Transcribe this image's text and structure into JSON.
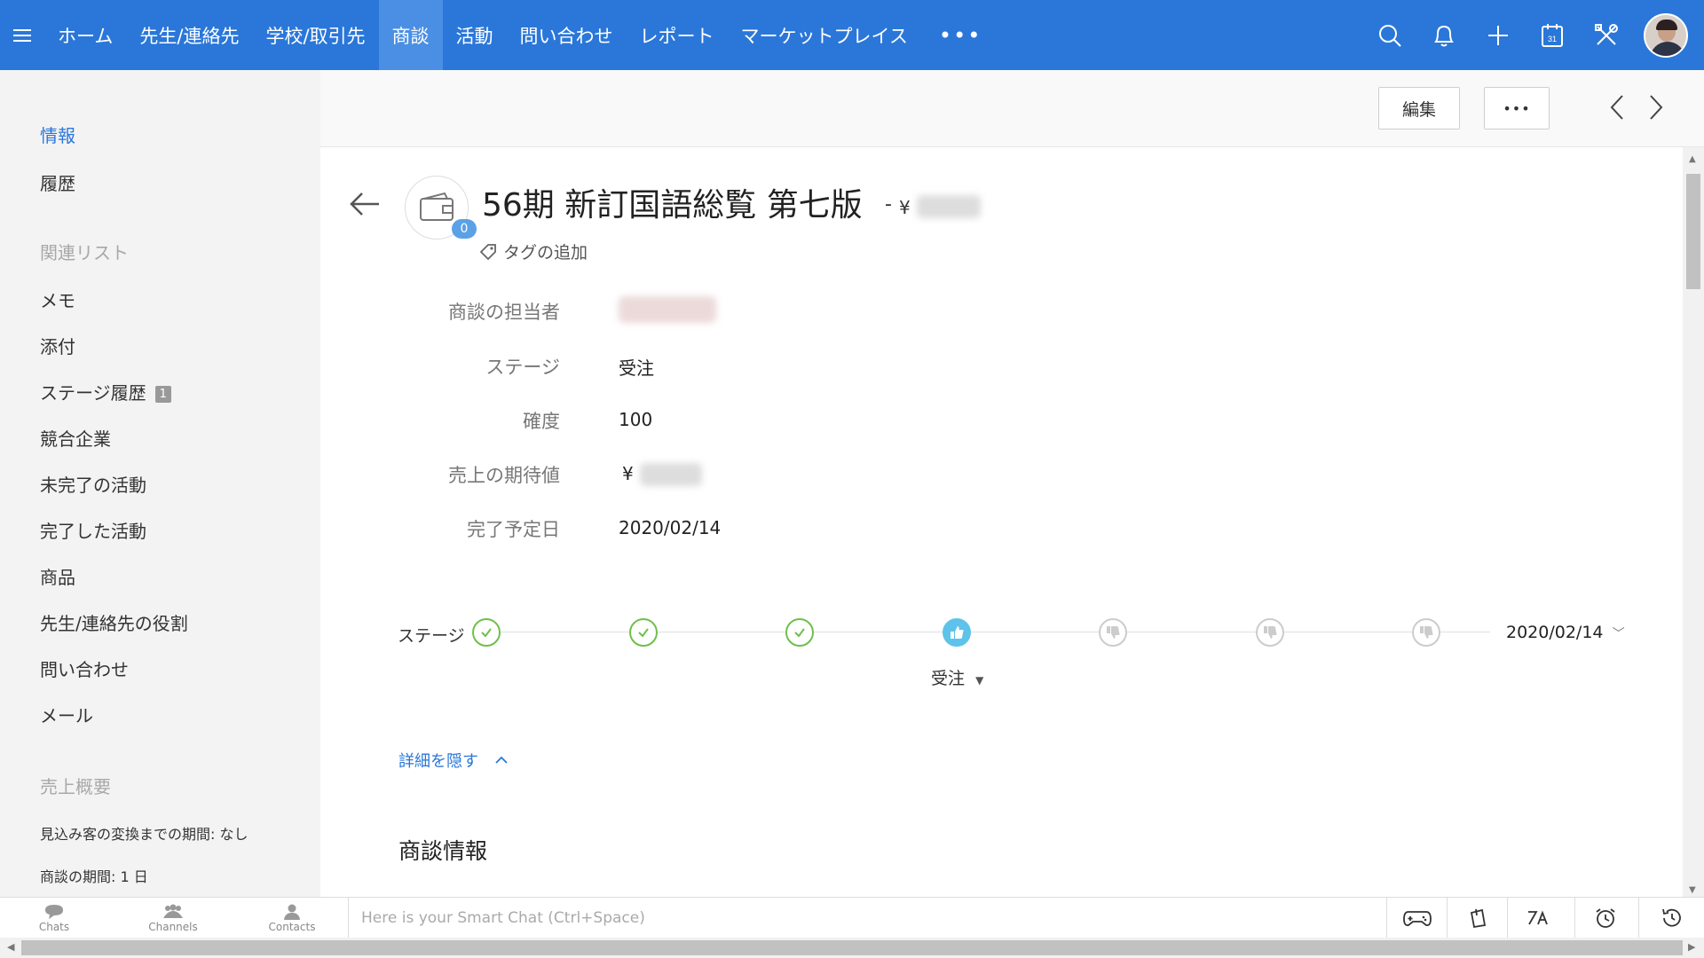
{
  "nav": {
    "items": [
      {
        "label": "ホーム",
        "active": false
      },
      {
        "label": "先生/連絡先",
        "active": false
      },
      {
        "label": "学校/取引先",
        "active": false
      },
      {
        "label": "商談",
        "active": true
      },
      {
        "label": "活動",
        "active": false
      },
      {
        "label": "問い合わせ",
        "active": false
      },
      {
        "label": "レポート",
        "active": false
      },
      {
        "label": "マーケットプレイス",
        "active": false
      }
    ],
    "more": "•••",
    "calendar_day": "31"
  },
  "sidebar": {
    "info": "情報",
    "history": "履歴",
    "related_heading": "関連リスト",
    "related": [
      {
        "label": "メモ"
      },
      {
        "label": "添付"
      },
      {
        "label": "ステージ履歴",
        "badge": "1"
      },
      {
        "label": "競合企業"
      },
      {
        "label": "未完了の活動"
      },
      {
        "label": "完了した活動"
      },
      {
        "label": "商品"
      },
      {
        "label": "先生/連絡先の役割"
      },
      {
        "label": "問い合わせ"
      },
      {
        "label": "メール"
      }
    ],
    "summary_heading": "売上概要",
    "summary": [
      "見込み客の変換までの期間: なし",
      "商談の期間: 1 日"
    ]
  },
  "toolbar": {
    "edit_label": "編集",
    "more_label": "•••"
  },
  "deal": {
    "title": "56期 新訂国語総覧 第七版",
    "separator": "-",
    "currency": "¥",
    "activity_count": "0",
    "tag_add": "タグの追加"
  },
  "fields": [
    {
      "label": "商談の担当者",
      "value": ""
    },
    {
      "label": "ステージ",
      "value": "受注"
    },
    {
      "label": "確度",
      "value": "100"
    },
    {
      "label": "売上の期待値",
      "value": "¥"
    },
    {
      "label": "完了予定日",
      "value": "2020/02/14"
    }
  ],
  "stage": {
    "label": "ステージ",
    "steps": [
      "done",
      "done",
      "done",
      "current",
      "lost",
      "lost",
      "lost"
    ],
    "current_label": "受注",
    "date": "2020/02/14"
  },
  "hide_details": "詳細を隠す",
  "section_title": "商談情報",
  "bottom": {
    "chats": "Chats",
    "channels": "Channels",
    "contacts": "Contacts",
    "chat_placeholder": "Here is your Smart Chat (Ctrl+Space)"
  },
  "colors": {
    "nav_bg": "#2a77d9",
    "nav_active": "#4a8fe3",
    "stage_done": "#6fbf4b",
    "stage_current": "#5ec3ea",
    "link": "#2a77d9"
  }
}
